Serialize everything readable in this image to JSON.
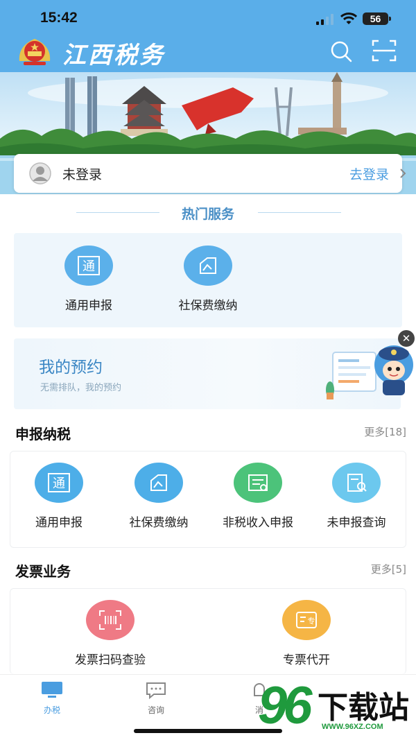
{
  "status_bar": {
    "time": "15:42",
    "battery": "56"
  },
  "header": {
    "title": "江西税务",
    "brand_color": "#5aaee9"
  },
  "login": {
    "status": "未登录",
    "link": "去登录"
  },
  "hot_services": {
    "title": "热门服务",
    "items": [
      {
        "label": "通用申报",
        "icon": "tong-icon"
      },
      {
        "label": "社保费缴纳",
        "icon": "social-security-icon"
      }
    ]
  },
  "appointment": {
    "title": "我的预约",
    "subtitle": "无需排队，我的预约"
  },
  "declare_tax": {
    "title": "申报纳税",
    "more": "更多[18]",
    "items": [
      {
        "label": "通用申报",
        "icon": "tong-icon",
        "color": "#4daee8"
      },
      {
        "label": "社保费缴纳",
        "icon": "social-security-icon",
        "color": "#4daee8"
      },
      {
        "label": "非税收入申报",
        "icon": "receipt-icon",
        "color": "#4cc37a"
      },
      {
        "label": "未申报查询",
        "icon": "document-search-icon",
        "color": "#6cc8ee"
      }
    ]
  },
  "invoice": {
    "title": "发票业务",
    "more": "更多[5]",
    "items": [
      {
        "label": "发票扫码查验",
        "icon": "barcode-scan-icon",
        "color": "#ef7a85"
      },
      {
        "label": "专票代开",
        "icon": "invoice-issue-icon",
        "color": "#f5b545"
      }
    ]
  },
  "bottom_nav": {
    "items": [
      {
        "label": "办税",
        "icon": "monitor-icon",
        "active": true
      },
      {
        "label": "咨询",
        "icon": "chat-icon",
        "active": false
      },
      {
        "label": "消",
        "icon": "message-icon",
        "active": false
      }
    ]
  },
  "watermark": {
    "number": "96",
    "text": "下载站",
    "url": "WWW.96XZ.COM"
  }
}
